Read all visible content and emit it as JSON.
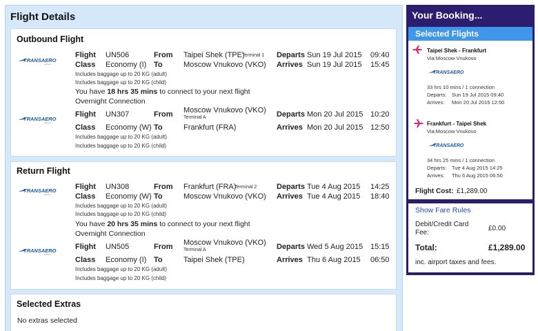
{
  "flight_details": {
    "title": "Flight Details",
    "airline_logo_text": "TRANSAERO",
    "outbound": {
      "title": "Outbound Flight",
      "segment1": {
        "flight_label": "Flight",
        "flight": "UN506",
        "class_label": "Class",
        "class": "Economy (I)",
        "from_label": "From",
        "from": "Taipei Shek (TPE)",
        "from_terminal": "Terminal 1",
        "to_label": "To",
        "to": "Moscow Vnukovo (VKO)",
        "departs_label": "Departs",
        "departs_date": "Sun 19 Jul 2015",
        "departs_time": "09:40",
        "arrives_label": "Arrives",
        "arrives_date": "Sun 19 Jul 2015",
        "arrives_time": "15:45",
        "baggage_adult": "Includes baggage up to 20 KG (adult)",
        "baggage_child": "Includes baggage up to 20 KG (child)"
      },
      "connection": {
        "prefix": "You have ",
        "duration": "18 hrs 35 mins",
        "suffix": " to connect to your next flight",
        "note": "Overnight Connection"
      },
      "segment2": {
        "flight_label": "Flight",
        "flight": "UN307",
        "class_label": "Class",
        "class": "Economy (W)",
        "from_label": "From",
        "from": "Moscow Vnukovo (VKO)",
        "from_terminal": "Terminal A",
        "to_label": "To",
        "to": "Frankfurt (FRA)",
        "departs_label": "Departs",
        "departs_date": "Mon 20 Jul 2015",
        "departs_time": "10:20",
        "arrives_label": "Arrives",
        "arrives_date": "Mon 20 Jul 2015",
        "arrives_time": "12:50",
        "baggage_adult": "Includes baggage up to 20 KG (adult)",
        "baggage_child": "Includes baggage up to 20 KG (child)"
      }
    },
    "return": {
      "title": "Return Flight",
      "segment1": {
        "flight_label": "Flight",
        "flight": "UN308",
        "class_label": "Class",
        "class": "Economy (W)",
        "from_label": "From",
        "from": "Frankfurt (FRA)",
        "from_terminal": "Terminal 2",
        "to_label": "To",
        "to": "Moscow Vnukovo (VKO)",
        "departs_label": "Departs",
        "departs_date": "Tue 4 Aug 2015",
        "departs_time": "14:25",
        "arrives_label": "Arrives",
        "arrives_date": "Tue 4 Aug 2015",
        "arrives_time": "18:40",
        "baggage_adult": "Includes baggage up to 20 KG (adult)",
        "baggage_child": "Includes baggage up to 20 KG (child)"
      },
      "connection": {
        "prefix": "You have ",
        "duration": "20 hrs 35 mins",
        "suffix": " to connect to your next flight",
        "note": "Overnight Connection"
      },
      "segment2": {
        "flight_label": "Flight",
        "flight": "UN505",
        "class_label": "Class",
        "class": "Economy (I)",
        "from_label": "From",
        "from": "Moscow Vnukovo (VKO)",
        "from_terminal": "Terminal A",
        "to_label": "To",
        "to": "Taipei Shek (TPE)",
        "departs_label": "Departs",
        "departs_date": "Wed 5 Aug 2015",
        "departs_time": "15:15",
        "arrives_label": "Arrives",
        "arrives_date": "Thu 6 Aug 2015",
        "arrives_time": "06:50",
        "baggage_adult": "Includes baggage up to 20 KG (adult)",
        "baggage_child": "Includes baggage up to 20 KG (child)"
      }
    },
    "extras": {
      "title": "Selected Extras",
      "text": "No extras selected"
    }
  },
  "booking": {
    "title": "Your Booking...",
    "selected_title": "Selected Flights",
    "outbound": {
      "route": "Taipei Shek - Frankfurt",
      "via": "Via:Moscow Vnukovo",
      "duration": "33 hrs 10 mins / 1 connection",
      "departs_label": "Departs:",
      "departs": "Sun 19 Jul 2015 09:40",
      "arrives_label": "Arrives:",
      "arrives": "Mon 20 Jul 2015 12:50"
    },
    "return": {
      "route": "Frankfurt - Taipei Shek",
      "via": "Via:Moscow Vnukovo",
      "duration": "34 hrs 25 mins / 1 connection",
      "departs_label": "Departs:",
      "departs": "Tue 4 Aug 2015 14:25",
      "arrives_label": "Arrives:",
      "arrives": "Thu 6 Aug 2015 06:50"
    },
    "flight_cost_label": "Flight Cost:",
    "flight_cost": "£1,289.00",
    "fare_rules_link": "Show Fare Rules",
    "card_fee_label_1": "Debit/Credit Card",
    "card_fee_label_2": "Fee:",
    "card_fee": "£0.00",
    "total_label": "Total:",
    "total": "£1,289.00",
    "tax_note": "inc. airport taxes and fees."
  },
  "colors": {
    "panel_bg": "#d6e9fb",
    "booking_bg": "#2c1d6e",
    "selected_header": "#3e97ea",
    "plane_pink": "#e0257a",
    "logo_blue": "#1e5aa8"
  }
}
